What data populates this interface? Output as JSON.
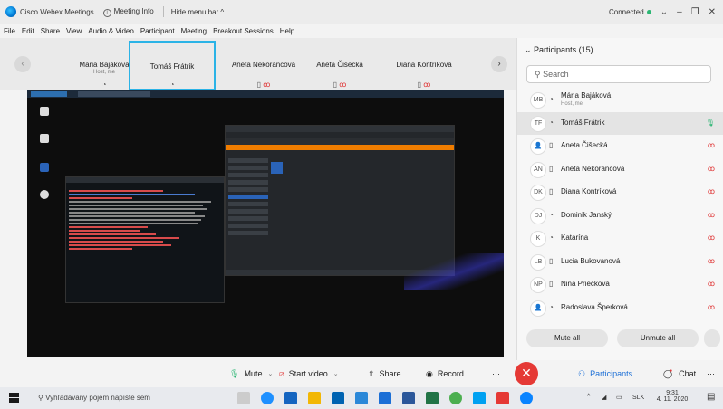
{
  "titlebar": {
    "app_title": "Cisco Webex Meetings",
    "meeting_info": "Meeting Info",
    "hide_menu": "Hide menu bar ^",
    "status": "Connected",
    "status_color": "#2bb673"
  },
  "menubar": [
    "File",
    "Edit",
    "Share",
    "View",
    "Audio & Video",
    "Participant",
    "Meeting",
    "Breakout Sessions",
    "Help"
  ],
  "tiles": [
    {
      "name": "Mária Bajáková",
      "sub": "Host, me",
      "active": false
    },
    {
      "name": "Tomáš Frátrik",
      "sub": "",
      "active": true
    },
    {
      "name": "Aneta Nekorancová",
      "sub": "",
      "active": false
    },
    {
      "name": "Aneta Čišecká",
      "sub": "",
      "active": false
    },
    {
      "name": "Diana Kontríková",
      "sub": "",
      "active": false
    }
  ],
  "controls": {
    "mute": "Mute",
    "start_video": "Start video",
    "share": "Share",
    "record": "Record",
    "more": "···",
    "participants": "Participants",
    "chat": "Chat",
    "extra": "···"
  },
  "panel": {
    "header": "Participants (15)",
    "search_placeholder": "Search",
    "participants": [
      {
        "initials": "MB",
        "name": "Mária Bajáková",
        "sub": "Host, me",
        "mic": ""
      },
      {
        "initials": "TF",
        "name": "Tomáš Frátrik",
        "sub": "",
        "mic": "on"
      },
      {
        "initials": "",
        "name": "Aneta Čišecká",
        "sub": "",
        "mic": "muted"
      },
      {
        "initials": "AN",
        "name": "Aneta Nekorancová",
        "sub": "",
        "mic": "muted"
      },
      {
        "initials": "DK",
        "name": "Diana Kontríková",
        "sub": "",
        "mic": "muted"
      },
      {
        "initials": "DJ",
        "name": "Dominik Janský",
        "sub": "",
        "mic": "muted"
      },
      {
        "initials": "K",
        "name": "Katarína",
        "sub": "",
        "mic": "muted"
      },
      {
        "initials": "LB",
        "name": "Lucia Bukovanová",
        "sub": "",
        "mic": "muted"
      },
      {
        "initials": "NP",
        "name": "Nina Priečková",
        "sub": "",
        "mic": "muted"
      },
      {
        "initials": "",
        "name": "Radoslava Šperková",
        "sub": "",
        "mic": "muted"
      }
    ],
    "mute_all": "Mute all",
    "unmute_all": "Unmute all",
    "more": "···"
  },
  "taskbar": {
    "search": "Vyhľadávaný pojem napíšte sem",
    "lang": "SLK",
    "time": "9:31",
    "date": "4. 11. 2020"
  }
}
